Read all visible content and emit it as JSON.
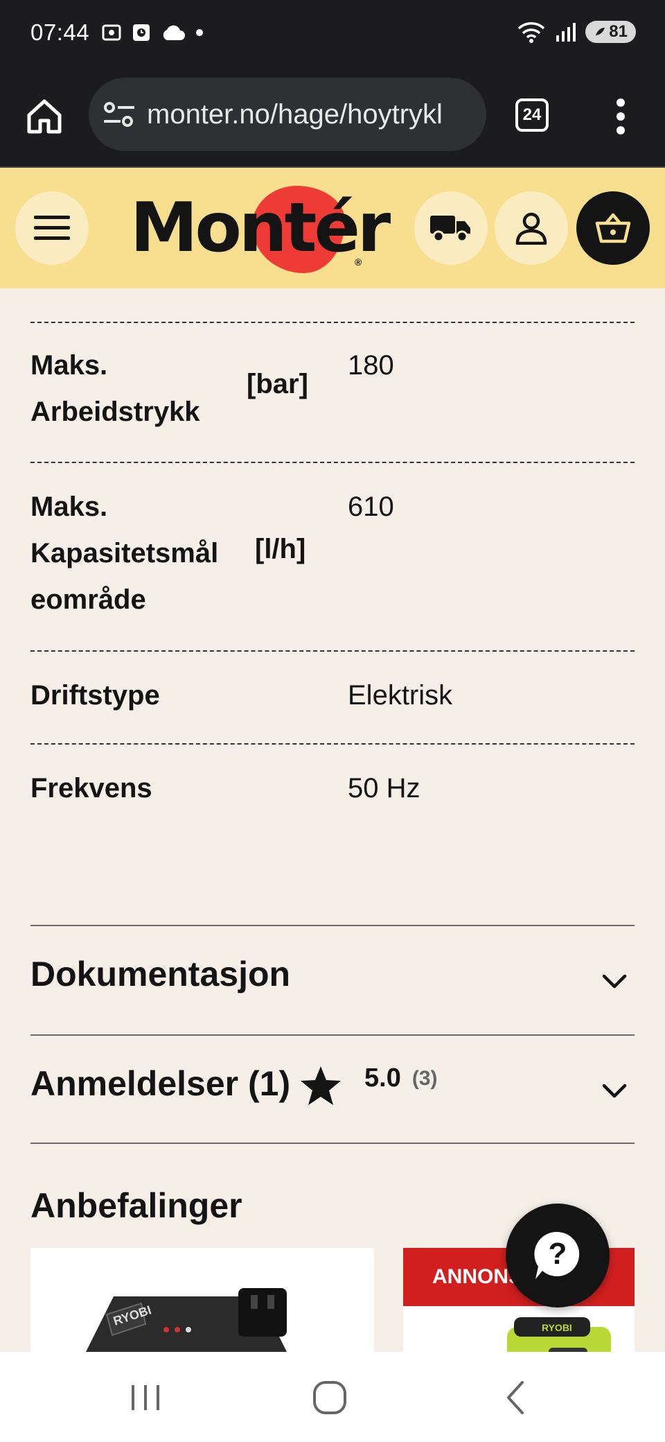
{
  "status_bar": {
    "time": "07:44",
    "battery": "81",
    "icons": [
      "screenshot-icon",
      "alarm-icon",
      "cloud-icon",
      "dot-icon",
      "wifi-icon",
      "signal-icon",
      "battery-icon"
    ]
  },
  "browser": {
    "url": "monter.no/hage/hoytrykl",
    "tab_count": "24"
  },
  "site_header": {
    "logo_text": "Montér",
    "logo_color": "#ee3b36",
    "header_color": "#f7df8f"
  },
  "specs": [
    {
      "name_lines": [
        "Maks.",
        "Arbeidstrykk"
      ],
      "unit": "[bar]",
      "value": "180"
    },
    {
      "name_lines": [
        "Maks.",
        "Kapasitetsmål",
        "eområde"
      ],
      "unit": "[l/h]",
      "value": "610"
    },
    {
      "name_lines": [
        "Driftstype"
      ],
      "unit": "",
      "value": "Elektrisk"
    },
    {
      "name_lines": [
        "Frekvens"
      ],
      "unit": "",
      "value": "50 Hz"
    }
  ],
  "accordions": {
    "documentation": {
      "title": "Dokumentasjon"
    },
    "reviews": {
      "title": "Anmeldelser (1)",
      "rating": "5.0",
      "rating_count": "(3)"
    }
  },
  "recommendations": {
    "title": "Anbefalinger",
    "ad_banner": "ANNONSØRERE",
    "products": [
      {
        "brand": "RYOBI"
      },
      {
        "brand": "RYOBI"
      }
    ]
  },
  "help_button_label": "?"
}
